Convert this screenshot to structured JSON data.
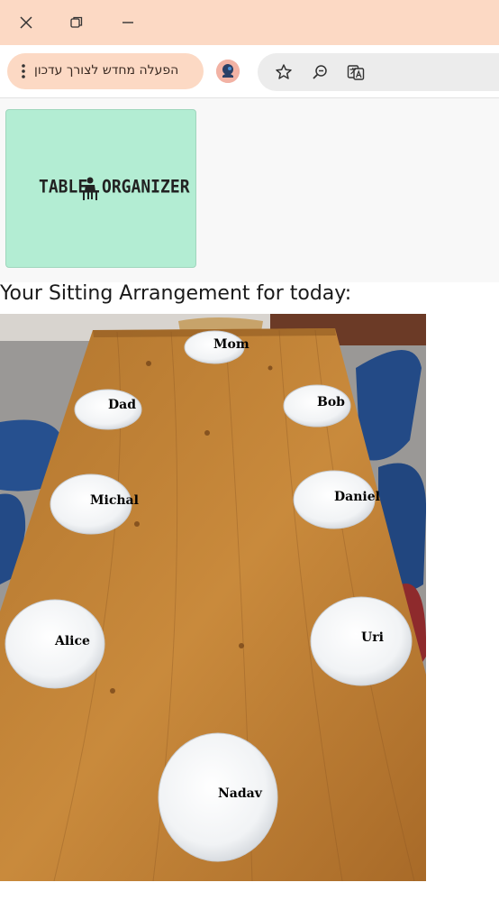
{
  "window": {
    "controls": [
      "close-icon",
      "restore-icon",
      "minimize-icon"
    ]
  },
  "toolbar": {
    "update_label": "הפעלה מחדש לצורך עדכון",
    "icons": [
      "menu-dots-icon",
      "profile-avatar-icon",
      "bookmark-star-icon",
      "zoom-out-icon",
      "translate-icon"
    ]
  },
  "logo": {
    "text_left": "TABLE",
    "text_right": "ORGANIZER",
    "background": "#b3edd3"
  },
  "page": {
    "heading": "Your Sitting Arrangement for today:"
  },
  "seats": [
    {
      "name": "Mom"
    },
    {
      "name": "Dad"
    },
    {
      "name": "Bob"
    },
    {
      "name": "Michal"
    },
    {
      "name": "Daniel"
    },
    {
      "name": "Alice"
    },
    {
      "name": "Uri"
    },
    {
      "name": "Nadav"
    }
  ]
}
